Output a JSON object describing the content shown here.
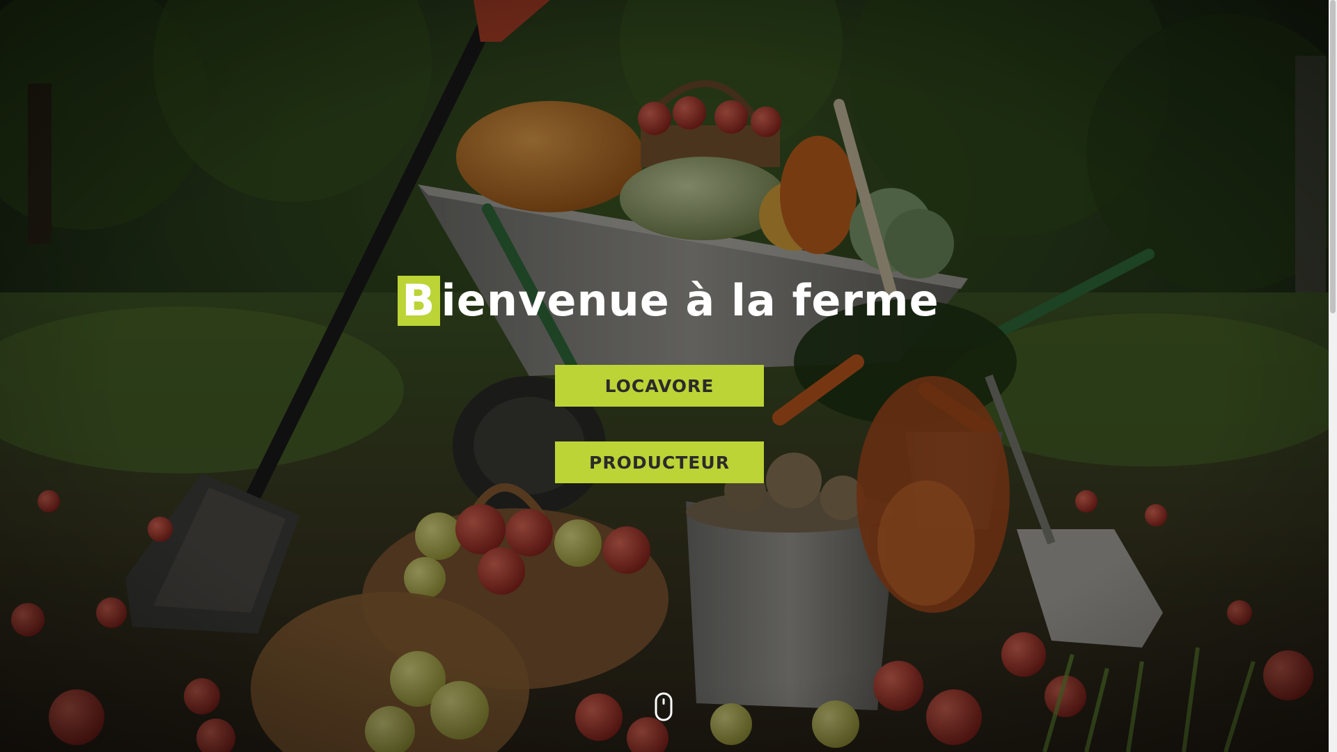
{
  "hero": {
    "title_first_letter": "B",
    "title_rest": "ienvenue à la ferme",
    "accent_color": "#bcd435",
    "background_scene": "farm produce in wheelbarrow, apple baskets, buckets of potatoes and onions, shovel in orchard grass"
  },
  "buttons": {
    "locavore_label": "LOCAVORE",
    "producteur_label": "PRODUCTEUR"
  },
  "scroll_indicator": {
    "icon": "mouse-icon"
  }
}
